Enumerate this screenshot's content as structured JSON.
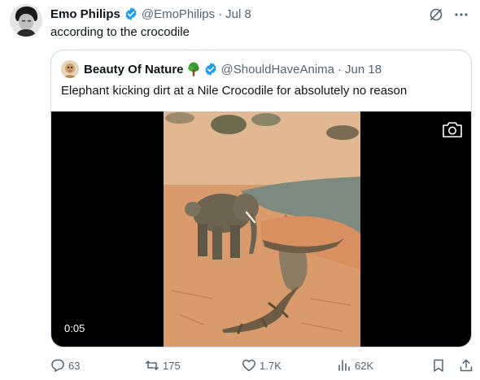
{
  "tweet": {
    "author_name": "Emo Philips",
    "author_handle": "@EmoPhilips",
    "separator": "·",
    "date": "Jul 8",
    "text": "according to the crocodile",
    "avatar_icon": "profile-photo",
    "verified_icon": "verified-badge-icon"
  },
  "quoted": {
    "author_name": "Beauty Of Nature",
    "author_handle": "@ShouldHaveAnima",
    "separator": "·",
    "date": "Jun 18",
    "text": "Elephant kicking dirt at a Nile Crocodile for absolutely no reason",
    "emoji_icon": "tree-icon",
    "video": {
      "duration": "0:05",
      "camera_icon": "camera-icon"
    }
  },
  "actions": {
    "replies": "63",
    "reposts": "175",
    "likes": "1.7K",
    "views": "62K"
  },
  "colors": {
    "accent": "#1d9bf0",
    "muted": "#536471",
    "border": "#cfd9de",
    "text": "#0f1419"
  }
}
